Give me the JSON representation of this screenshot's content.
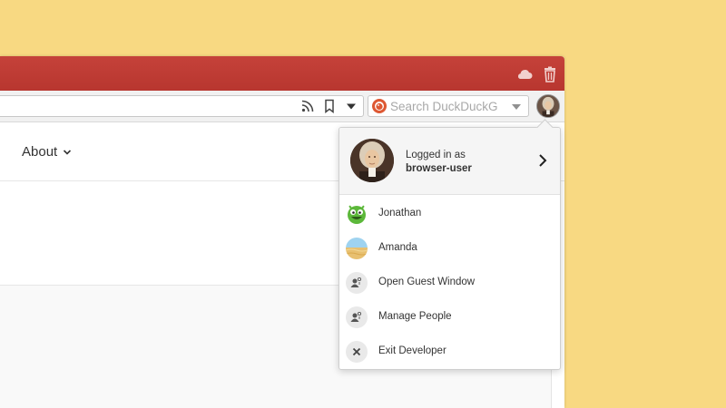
{
  "nav": {
    "about_label": "About"
  },
  "search": {
    "placeholder": "Search DuckDuckG"
  },
  "profile_panel": {
    "logged_in_as": "Logged in as",
    "username": "browser-user",
    "items": [
      {
        "label": "Jonathan",
        "icon": "green-monster-avatar"
      },
      {
        "label": "Amanda",
        "icon": "beach-avatar"
      },
      {
        "label": "Open Guest Window",
        "icon": "guest-person-icon"
      },
      {
        "label": "Manage People",
        "icon": "manage-people-icon"
      },
      {
        "label": "Exit Developer",
        "icon": "close-icon"
      }
    ]
  },
  "colors": {
    "background": "#f8d982",
    "titlebar": "#c03d35",
    "duckduckgo": "#de5833"
  }
}
